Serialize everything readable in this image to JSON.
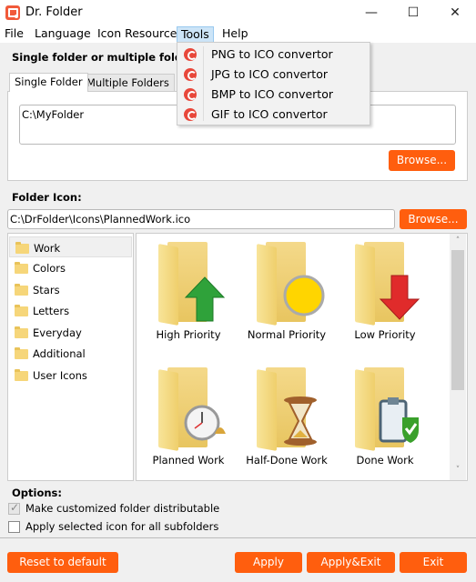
{
  "window": {
    "title": "Dr. Folder",
    "minimize": "—",
    "maximize": "☐",
    "close": "✕"
  },
  "menubar": [
    "File",
    "Language",
    "Icon Resource",
    "Tools",
    "Help"
  ],
  "tools_menu": [
    "PNG to ICO convertor",
    "JPG to ICO convertor",
    "BMP to ICO convertor",
    "GIF to ICO convertor"
  ],
  "folders_section": {
    "label": "Single folder or multiple folders:",
    "tabs": [
      "Single Folder",
      "Multiple Folders"
    ],
    "path": "C:\\MyFolder",
    "browse": "Browse..."
  },
  "icon_section": {
    "label": "Folder Icon:",
    "path": "C:\\DrFolder\\Icons\\PlannedWork.ico",
    "browse": "Browse..."
  },
  "categories": [
    "Work",
    "Colors",
    "Stars",
    "Letters",
    "Everyday",
    "Additional",
    "User Icons"
  ],
  "icons": [
    "High Priority",
    "Normal Priority",
    "Low Priority",
    "Planned Work",
    "Half-Done Work",
    "Done Work"
  ],
  "scrollbar": {
    "up": "˄",
    "down": "˅"
  },
  "options": {
    "label": "Options:",
    "distributable": "Make customized folder distributable",
    "subfolders": "Apply selected icon for all subfolders"
  },
  "footer": {
    "reset": "Reset to default",
    "apply": "Apply",
    "apply_exit": "Apply&Exit",
    "exit": "Exit"
  },
  "colors": {
    "accent": "#ff5e0e",
    "menu_highlight": "#cce4f7"
  }
}
